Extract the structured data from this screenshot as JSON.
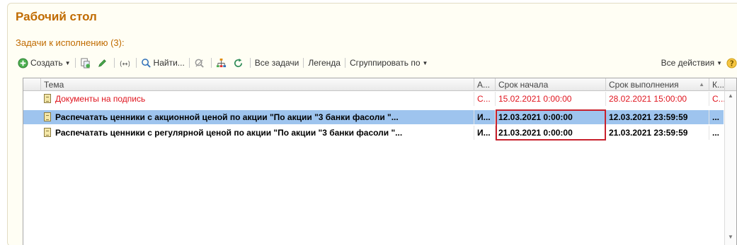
{
  "page": {
    "title": "Рабочий стол",
    "subtitle": "Задачи к исполнению (3):"
  },
  "toolbar": {
    "create_label": "Создать",
    "find_label": "Найти...",
    "all_tasks_label": "Все задачи",
    "legend_label": "Легенда",
    "group_by_label": "Сгруппировать по",
    "all_actions_label": "Все действия",
    "help_label": "?"
  },
  "table": {
    "columns": [
      "Тема",
      "А...",
      "Срок начала",
      "Срок выполнения",
      "К..."
    ],
    "sorted_column": "Срок выполнения",
    "rows": [
      {
        "subject": "Документы на подпись",
        "author": "С...",
        "start": "15.02.2021 0:00:00",
        "due": "28.02.2021 15:00:00",
        "k": "С...",
        "style": "overdue"
      },
      {
        "subject": "Распечатать ценники с акционной ценой по акции \"По акции \"3 банки фасоли \"...",
        "author": "И...",
        "start": "12.03.2021 0:00:00",
        "due": "12.03.2021 23:59:59",
        "k": "...",
        "style": "selected"
      },
      {
        "subject": "Распечатать ценники с регулярной ценой по акции \"По акции \"3 банки фасоли \"...",
        "author": "И...",
        "start": "21.03.2021 0:00:00",
        "due": "21.03.2021 23:59:59",
        "k": "...",
        "style": "bold"
      }
    ]
  },
  "colors": {
    "title": "#c06b00",
    "overdue_text": "#e0141e",
    "selection": "#9ec4ee",
    "highlight_frame": "#c8202c"
  },
  "icons": [
    "add-circle-icon",
    "copy-icon",
    "edit-pencil-icon",
    "link-icon",
    "search-icon",
    "clear-search-icon",
    "tree-structure-icon",
    "refresh-icon",
    "help-icon",
    "task-document-icon"
  ]
}
